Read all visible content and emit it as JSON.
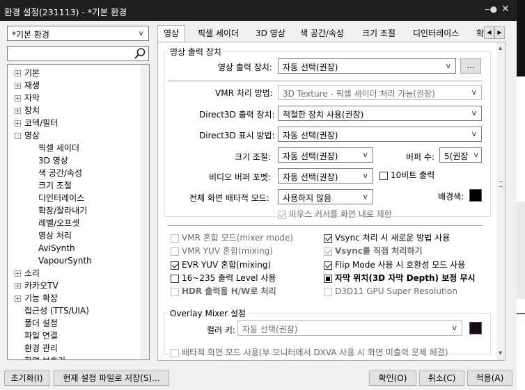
{
  "window": {
    "title": "환경 설정(231113) - *기본 환경",
    "pin_icon": "pin-icon",
    "close_icon": "close-icon"
  },
  "profile": {
    "selected": "*기본 환경",
    "arrow": "v"
  },
  "search": {
    "value": "",
    "icon": "search-icon"
  },
  "tree": {
    "items": [
      {
        "label": "기본",
        "expander": "+"
      },
      {
        "label": "재생",
        "expander": "+"
      },
      {
        "label": "자막",
        "expander": "+"
      },
      {
        "label": "장치",
        "expander": "+"
      },
      {
        "label": "코덱/필터",
        "expander": "+"
      },
      {
        "label": "영상",
        "expander": "-"
      },
      {
        "label": "픽셀 세이더"
      },
      {
        "label": "3D 영상"
      },
      {
        "label": "색 공간/속성"
      },
      {
        "label": "크기 조절"
      },
      {
        "label": "디인터레이스"
      },
      {
        "label": "확장/잘라내기"
      },
      {
        "label": "레벨/오프셋"
      },
      {
        "label": "영상 처리"
      },
      {
        "label": "AviSynth"
      },
      {
        "label": "VapourSynth"
      },
      {
        "label": "소리",
        "expander": "+"
      },
      {
        "label": "카카오TV",
        "expander": "+"
      },
      {
        "label": "기능 확장",
        "expander": "+"
      },
      {
        "label": "접근성 (TTS/UIA)"
      },
      {
        "label": "폴더 설정"
      },
      {
        "label": "파일 연결"
      },
      {
        "label": "환경 관리"
      },
      {
        "label": "화면 보호기"
      }
    ]
  },
  "tabs": [
    "영상",
    "픽셀 세이더",
    "3D 영상",
    "색 공간/속성",
    "크기 조절",
    "디인터레이스",
    "확"
  ],
  "tab_nav": {
    "left": "◀",
    "right": "▶"
  },
  "video_output": {
    "group_title": "영상 출력 장치",
    "device_label": "영상 출력 장치:",
    "device_value": "자동 선택(권장)",
    "browse_button": "...",
    "vmr_label": "VMR 처리 방법:",
    "vmr_value": "3D Texture - 픽셀 세이더 처리 가능(권장)",
    "d3d_out_label": "Direct3D 출력 장치:",
    "d3d_out_value": "적절한 장치 사용(권장)",
    "d3d_disp_label": "Direct3D 표시 방법:",
    "d3d_disp_value": "자동 선택(권장)",
    "resize_label": "크기 조절:",
    "resize_value": "자동 선택(권장)",
    "buffer_label": "버퍼 수:",
    "buffer_value": "5(권장",
    "vbuf_label": "비디오 버퍼 포멧:",
    "vbuf_value": "자동 선택(권장)",
    "tenbit_label": "10비트 출력",
    "fullscreen_label": "전체 화면 배타적 모드:",
    "fullscreen_value": "사용하지 않음",
    "bgcolor_label": "배경색:",
    "bgcolor": "#000000",
    "mouse_limit_label": "마우스 커서를 화면 내로 제한"
  },
  "options": {
    "vmr_mix": "VMR 혼합 모드(mixer mode)",
    "vmr_yuv": "VMR YUV 혼합(mixing)",
    "evr_yuv": "EVR YUV 혼합(mixing)",
    "level16": "16~235 출력 Level 사용",
    "hdr": "HDR 출력을 H/W로 처리",
    "vsync_new": "Vsync 처리 시 새로운 방법 사용",
    "vsync_direct": "Vsync를 직접 처리하기",
    "flip_mode": "Flip Mode 사용 시 호환성 모드 사용",
    "subtitle_pos": "자막 위치(3D 자막 Depth) 보정 무시",
    "d3d11_sr": "D3D11 GPU Super Resolution"
  },
  "overlay": {
    "group_title": "Overlay Mixer 설정",
    "color_key_label": "컬러 키:",
    "color_key_value": "자동 선택(권장)",
    "color_key_swatch": "#1a0a14",
    "exclusive_label": "배타적 화면 모드 사용(부 모니터에서 DXVA 사용 시 화면 미출력 문제 해결)"
  },
  "footer": {
    "reset": "초기화(I)",
    "save_current": "현재 설정 파일로 저장(S)...",
    "ok": "확인(O)",
    "cancel": "취소(C)",
    "apply": "적용(A)"
  },
  "colors": {
    "titlebar": "#1f1f1f",
    "dialog_bg": "#f0f0f0"
  }
}
